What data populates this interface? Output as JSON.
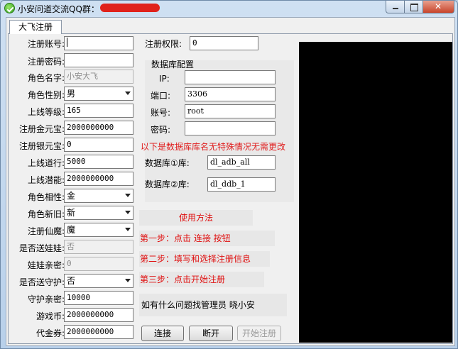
{
  "window": {
    "title": "小安问道交流QQ群："
  },
  "tabs": [
    {
      "label": "大飞注册"
    }
  ],
  "form": {
    "account_label": "注册账号:",
    "account_value": "",
    "password_label": "注册密码:",
    "password_value": "",
    "role_name_label": "角色名字:",
    "role_name_value": "小安大飞",
    "gender_label": "角色性别:",
    "gender_value": "男",
    "level_label": "上线等级:",
    "level_value": "165",
    "gold_label": "注册金元宝:",
    "gold_value": "2000000000",
    "silver_label": "注册银元宝:",
    "silver_value": "0",
    "daoxing_label": "上线道行:",
    "daoxing_value": "5000",
    "potential_label": "上线潜能:",
    "potential_value": "2000000000",
    "element_label": "角色相性:",
    "element_value": "金",
    "newold_label": "角色新旧:",
    "newold_value": "新",
    "xianmo_label": "注册仙魔:",
    "xianmo_value": "魔",
    "send_doll_label": "是否送娃娃:",
    "send_doll_value": "否",
    "doll_intimacy_label": "娃娃亲密:",
    "doll_intimacy_value": "0",
    "send_guardian_label": "是否送守护:",
    "send_guardian_value": "否",
    "guardian_intimacy_label": "守护亲密:",
    "guardian_intimacy_value": "10000",
    "coins_label": "游戏币:",
    "coins_value": "2000000000",
    "voucher_label": "代金券:",
    "voucher_value": "2000000000",
    "permission_label": "注册权限:",
    "permission_value": "0"
  },
  "db": {
    "title": "数据库配置",
    "ip_label": "IP:",
    "ip_value": "",
    "port_label": "端口:",
    "port_value": "3306",
    "user_label": "账号:",
    "user_value": "root",
    "pass_label": "密码:",
    "pass_value": "",
    "note": "以下是数据库库名无特殊情况无需更改",
    "db1_label": "数据库①库:",
    "db1_value": "dl_adb_all",
    "db2_label": "数据库②库:",
    "db2_value": "dl_ddb_1"
  },
  "howto": {
    "title": "使用方法",
    "step1": "第一步：点击 连接 按钮",
    "step2": "第二步：填写和选择注册信息",
    "step3": "第三步：点击开始注册"
  },
  "contact": "如有什么问题找管理员 晓小安",
  "buttons": {
    "connect": "连接",
    "disconnect": "断开",
    "start": "开始注册"
  },
  "colors": {
    "accent_red": "#e02020",
    "output_panel": "#000000"
  }
}
